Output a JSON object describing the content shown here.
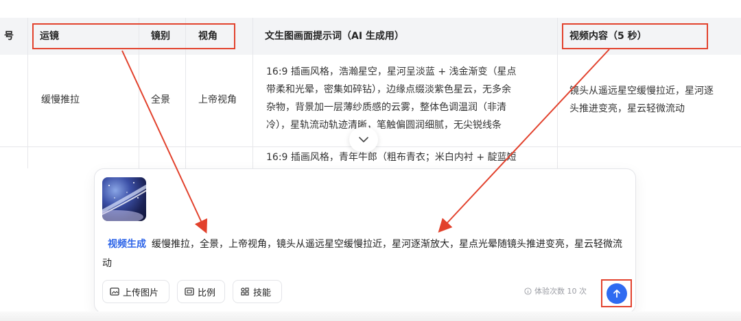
{
  "table": {
    "headers": {
      "index": "号",
      "movement": "运镜",
      "shot": "镜别",
      "angle": "视角",
      "prompt": "文生图画面提示词（AI 生成用）",
      "video": "视频内容（5 秒）"
    },
    "row1": {
      "movement": "缓慢推拉",
      "shot": "全景",
      "angle": "上帝视角",
      "prompt_lines": [
        "16:9 插画风格，浩瀚星空，星河呈淡蓝 + 浅金渐变（星点",
        "带柔和光晕，密集如碎钻），边缘点缀淡紫色星云，无多余",
        "杂物，背景加一层薄纱质感的云雾，整体色调温润（非清",
        "冷），星轨流动轨迹清晰，笔触偏圆润细腻，无尖锐线条"
      ],
      "video_lines": [
        "镜头从遥远星空缓慢拉近，星河逐",
        "头推进变亮，星云轻微流动"
      ]
    },
    "row2": {
      "prompt_partial": "16:9 插画风格，青年牛郎（粗布青衣；米白内衬 + 靛蓝短"
    }
  },
  "composer": {
    "skill_tag": "视频生成",
    "message": "缓慢推拉，全景，上帝视角，镜头从遥远星空缓慢拉近，星河逐渐放大，星点光晕随镜头推进变亮，星云轻微流动",
    "tools": {
      "upload": "上传图片",
      "ratio": "比例",
      "skills": "技能"
    },
    "quota": "体验次数 10 次"
  },
  "colors": {
    "highlight": "#e2412c",
    "accent": "#2f6bf1",
    "header_bg": "#f3f4f6"
  },
  "icons": [
    "chevron-down-icon",
    "image-icon",
    "ratio-icon",
    "skills-icon",
    "info-icon",
    "arrow-up-icon"
  ]
}
